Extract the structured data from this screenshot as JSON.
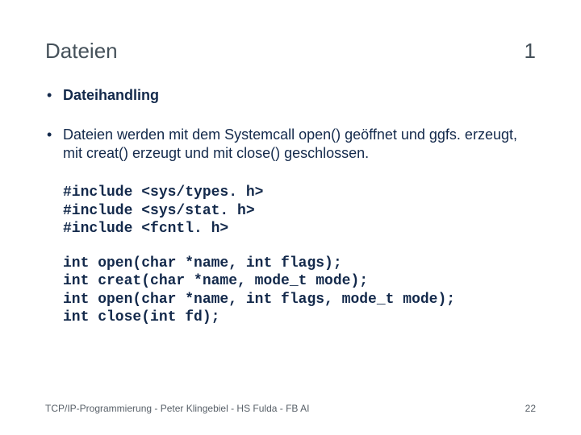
{
  "title": {
    "text": "Dateien",
    "number": "1"
  },
  "bullets": [
    {
      "text": "Dateihandling",
      "bold": true
    },
    {
      "text": "Dateien werden mit dem Systemcall open() geöffnet und ggfs. erzeugt, mit creat() erzeugt und mit close() geschlossen.",
      "bold": false
    }
  ],
  "code_blocks": [
    "#include <sys/types. h>\n#include <sys/stat. h>\n#include <fcntl. h>",
    "int open(char *name, int flags);\nint creat(char *name, mode_t mode);\nint open(char *name, int flags, mode_t mode);\nint close(int fd);"
  ],
  "footer": {
    "left": "TCP/IP-Programmierung - Peter Klingebiel - HS Fulda - FB AI",
    "right": "22"
  }
}
